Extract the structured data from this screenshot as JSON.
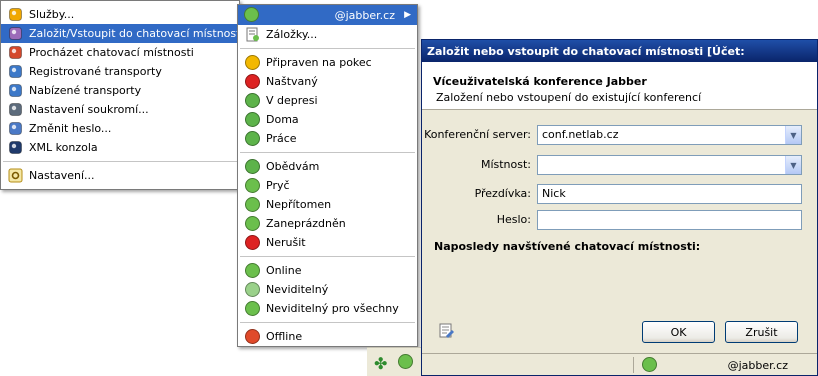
{
  "main_menu": {
    "items": [
      {
        "label": "Služby...",
        "icon": "services-icon",
        "color": "#f0a800"
      },
      {
        "label": "Založit/Vstoupit do chatovací místnosti",
        "icon": "conference-join-icon",
        "color": "#9c6bb9"
      },
      {
        "label": "Procházet chatovací místnosti",
        "icon": "conference-browse-icon",
        "color": "#d4482c"
      },
      {
        "label": "Registrované transporty",
        "icon": "transport-registered-icon",
        "color": "#3c78c8"
      },
      {
        "label": "Nabízené transporty",
        "icon": "transport-offered-icon",
        "color": "#3c78c8"
      },
      {
        "label": "Nastavení soukromí...",
        "icon": "privacy-icon",
        "color": "#5c6b7c"
      },
      {
        "label": "Změnit heslo...",
        "icon": "password-key-icon",
        "color": "#4a79c6"
      },
      {
        "label": "XML konzola",
        "icon": "xml-console-icon",
        "color": "#1f3a6b"
      }
    ],
    "settings_label": "Nastavení...",
    "selected_index": 1
  },
  "status_menu": {
    "account": "@jabber.cz",
    "bookmarks_label": "Záložky...",
    "groups": [
      [
        {
          "label": "Připraven na pokec",
          "icon": "status-chat-icon",
          "color": "#f2b800"
        },
        {
          "label": "Naštvaný",
          "icon": "status-angry-icon",
          "color": "#d22"
        },
        {
          "label": "V depresi",
          "icon": "status-depressed-icon",
          "color": "#5db34a"
        },
        {
          "label": "Doma",
          "icon": "status-home-icon",
          "color": "#5db34a"
        },
        {
          "label": "Práce",
          "icon": "status-work-icon",
          "color": "#5db34a"
        }
      ],
      [
        {
          "label": "Obědvám",
          "icon": "status-lunch-icon",
          "color": "#5db34a"
        },
        {
          "label": "Pryč",
          "icon": "status-away-icon",
          "color": "#6bbf4c"
        },
        {
          "label": "Nepřítomen",
          "icon": "status-xa-icon",
          "color": "#6bbf4c"
        },
        {
          "label": "Zaneprázdněn",
          "icon": "status-busy-icon",
          "color": "#6bbf4c"
        },
        {
          "label": "Nerušit",
          "icon": "status-dnd-icon",
          "color": "#d22"
        }
      ],
      [
        {
          "label": "Online",
          "icon": "status-online-icon",
          "color": "#6bbf4c"
        },
        {
          "label": "Neviditelný",
          "icon": "status-invisible-icon",
          "color": "#9ad18a"
        },
        {
          "label": "Neviditelný pro všechny",
          "icon": "status-invisible-all-icon",
          "color": "#6bbf4c"
        }
      ],
      [
        {
          "label": "Offline",
          "icon": "status-offline-icon",
          "color": "#e04a2a"
        }
      ]
    ]
  },
  "dialog": {
    "title": "Založit nebo vstoupit do chatovací místnosti [Účet:",
    "heading": "Víceuživatelská konference Jabber",
    "subheading": "Založení nebo vstoupení do existující konferencí",
    "server_label": "Konferenční server:",
    "server_value": "conf.netlab.cz",
    "room_label": "Místnost:",
    "room_value": "",
    "nick_label": "Přezdívka:",
    "nick_value": "Nick",
    "password_label": "Heslo:",
    "password_value": "",
    "recent_label": "Naposledy navštívené chatovací místnosti:",
    "ok_label": "OK",
    "cancel_label": "Zrušit",
    "status_account": "@jabber.cz"
  }
}
